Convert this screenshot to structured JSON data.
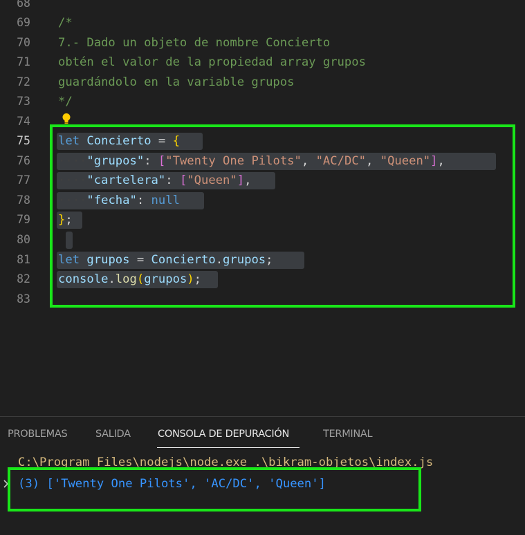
{
  "editor": {
    "lines": [
      {
        "num": "68",
        "text": ""
      },
      {
        "num": "69",
        "text": "/*"
      },
      {
        "num": "70",
        "text": "7.- Dado un objeto de nombre Concierto"
      },
      {
        "num": "71",
        "text": "obtén el valor de la propiedad array grupos"
      },
      {
        "num": "72",
        "text": "guardándolo en la variable grupos"
      },
      {
        "num": "73",
        "text": "*/"
      },
      {
        "num": "74",
        "text": ""
      },
      {
        "num": "75",
        "text": "let Concierto = {"
      },
      {
        "num": "76",
        "text": "    \"grupos\": [\"Twenty One Pilots\", \"AC/DC\", \"Queen\"],"
      },
      {
        "num": "77",
        "text": "    \"cartelera\": [\"Queen\"],"
      },
      {
        "num": "78",
        "text": "    \"fecha\": null"
      },
      {
        "num": "79",
        "text": "};"
      },
      {
        "num": "80",
        "text": ""
      },
      {
        "num": "81",
        "text": "let grupos = Concierto.grupos;"
      },
      {
        "num": "82",
        "text": "console.log(grupos);"
      },
      {
        "num": "83",
        "text": ""
      }
    ],
    "active_line": "75",
    "tokens": {
      "let": "let",
      "concierto": "Concierto",
      "eq": " = ",
      "open_brace": "{",
      "close_brace": "}",
      "semi": ";",
      "key_grupos": "\"grupos\"",
      "key_cartelera": "\"cartelera\"",
      "key_fecha": "\"fecha\"",
      "colon": ": ",
      "comma": ", ",
      "comma_end": ",",
      "open_bracket": "[",
      "close_bracket": "]",
      "s_top": "\"Twenty One Pilots\"",
      "s_acdc": "\"AC/DC\"",
      "s_queen": "\"Queen\"",
      "null": "null",
      "grupos": "grupos",
      "dot": ".",
      "console": "console",
      "log": "log",
      "open_paren": "(",
      "close_paren": ")"
    }
  },
  "panel": {
    "tabs": [
      "PROBLEMAS",
      "SALIDA",
      "CONSOLA DE DEPURACIÓN",
      "TERMINAL"
    ],
    "active_tab": "CONSOLA DE DEPURACIÓN",
    "console_lines": [
      "C:\\Program Files\\nodejs\\node.exe .\\bikram-objetos\\index.js",
      "(3) ['Twenty One Pilots', 'AC/DC', 'Queen']"
    ]
  },
  "colors": {
    "background": "#1f1f1f",
    "highlight_box": "#19e619",
    "comment": "#6a9955",
    "keyword": "#569cd6",
    "variable": "#9cdcfe",
    "string": "#ce9178",
    "console_output": "#3794ff",
    "console_path": "#d7ba7d"
  },
  "icons": [
    "lightbulb-icon",
    "chevron-right-icon"
  ]
}
